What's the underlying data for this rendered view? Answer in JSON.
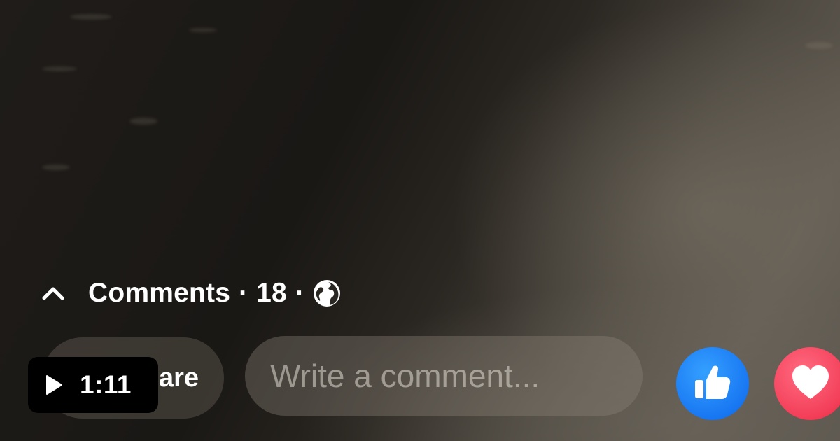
{
  "comments_bar": {
    "label": "Comments",
    "separator": "·",
    "count": "18"
  },
  "actions": {
    "share_label": "are"
  },
  "comment_box": {
    "placeholder": "Write a comment..."
  },
  "reactions": [
    {
      "name": "like",
      "color": "#1877f2",
      "icon": "thumbs-up-icon"
    },
    {
      "name": "love",
      "color": "#f33e58",
      "icon": "heart-icon"
    }
  ],
  "video": {
    "duration": "1:11",
    "play_icon": "play-icon"
  },
  "icons": {
    "collapse": "chevron-up-icon",
    "audience": "globe-icon"
  }
}
